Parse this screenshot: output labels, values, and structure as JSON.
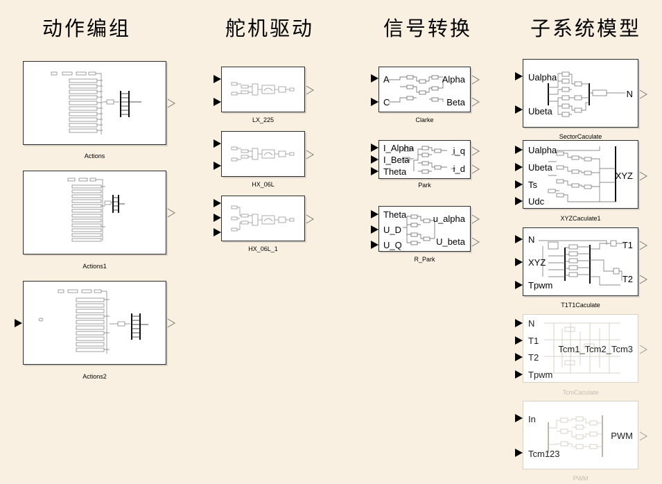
{
  "headings": {
    "actions": "动作编组",
    "servo": "舵机驱动",
    "signal": "信号转换",
    "subsystem": "子系统模型"
  },
  "blocks": {
    "actions": "Actions",
    "actions1": "Actions1",
    "actions2": "Actions2",
    "lx225": "LX_225",
    "hx06l": "HX_06L",
    "hx06l1": "HX_06L_1",
    "clarke": {
      "name": "Clarke",
      "in": [
        "A",
        "C"
      ],
      "out": [
        "Alpha",
        "Beta"
      ]
    },
    "park": {
      "name": "Park",
      "in": [
        "I_Alpha",
        "I_Beta",
        "Theta"
      ],
      "out": [
        "i_q",
        "i_d"
      ]
    },
    "rpark": {
      "name": "R_Park",
      "in": [
        "Theta",
        "U_D",
        "U_Q"
      ],
      "out": [
        "u_alpha",
        "U_beta"
      ]
    },
    "sector": {
      "name": "SectorCaculate",
      "in": [
        "Ualpha",
        "Ubeta"
      ],
      "out": [
        "N"
      ]
    },
    "xyz": {
      "name": "XYZCaculate1",
      "in": [
        "Ualpha",
        "Ubeta",
        "Ts",
        "Udc"
      ],
      "out": [
        "XYZ"
      ]
    },
    "t1t1": {
      "name": "T1T1Caculate",
      "in": [
        "N",
        "XYZ",
        "Tpwm"
      ],
      "out": [
        "T1",
        "T2"
      ]
    },
    "tcm": {
      "name": "TcmCaculate",
      "in": [
        "N",
        "T1",
        "T2",
        "Tpwm"
      ],
      "out": [
        "Tcm1_Tcm2_Tcm3"
      ]
    },
    "pwm": {
      "name": "PWM",
      "in": [
        "In",
        "Tcm123"
      ],
      "out": [
        "PWM"
      ]
    }
  }
}
